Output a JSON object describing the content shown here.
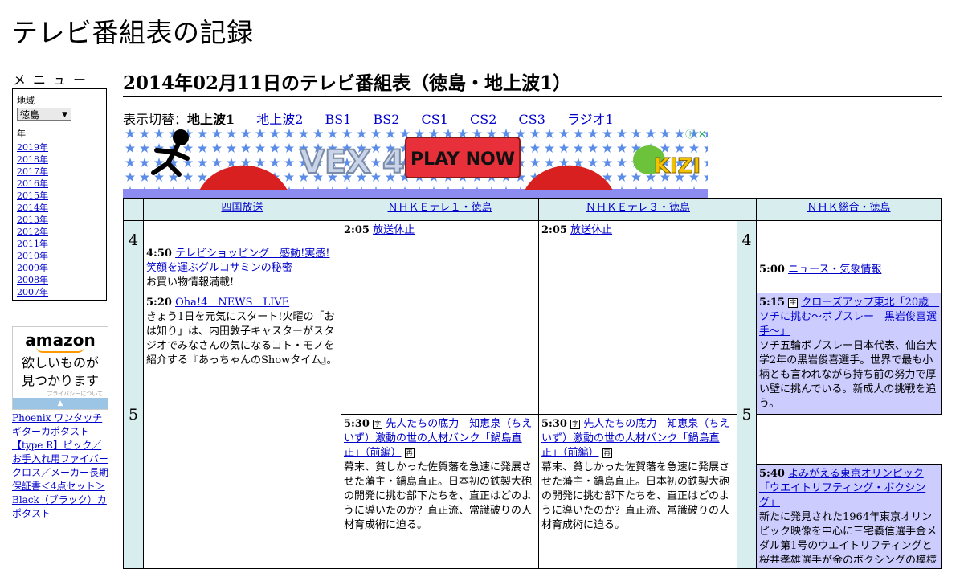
{
  "site_title": "テレビ番組表の記録",
  "menu": {
    "title": "メニュー",
    "region_label": "地域",
    "region_value": "徳島",
    "year_label": "年",
    "years": [
      "2019年",
      "2018年",
      "2017年",
      "2016年",
      "2015年",
      "2014年",
      "2013年",
      "2012年",
      "2011年",
      "2010年",
      "2009年",
      "2008年",
      "2007年"
    ]
  },
  "amazon_ad": {
    "logo": "amazon",
    "message_line1": "欲しいものが",
    "message_line2": "見つかります",
    "privacy": "プライバシーについて",
    "toggle": "▲"
  },
  "product_link": "Phoenix ワンタッチ ギターカポタスト【type R】ピック／お手入れ用ファイバークロス／メーカー長期保証書＜4点セット＞Black（ブラック）カポタスト",
  "page_title": "2014年02月11日のテレビ番組表（徳島・地上波1）",
  "switcher": {
    "label": "表示切替：",
    "current": "地上波1",
    "links": [
      "地上波2",
      "BS1",
      "BS2",
      "CS1",
      "CS2",
      "CS3",
      "ラジオ1"
    ]
  },
  "banner_ad": {
    "game": "VEX 4",
    "cta": "PLAY NOW",
    "brand": "KIZI",
    "info": "ⓘ",
    "close": "✕"
  },
  "schedule": {
    "channels": [
      "四国放送",
      "ＮＨＫＥテレ１・徳島",
      "ＮＨＫＥテレ３・徳島",
      "ＮＨＫ総合・徳島"
    ],
    "hours": [
      "4",
      "5"
    ],
    "programs": {
      "shikoku_450": {
        "time": "4:50",
        "title": "テレビショッピング　感動!実感!笑顔を運ぶグルコサミンの秘密",
        "desc": "お買い物情報満載!"
      },
      "shikoku_520": {
        "time": "5:20",
        "title": "Oha!4　NEWS　LIVE",
        "desc": "きょう1日を元気にスタート!火曜の「お は知り」は、内田敦子キャスターがスタジオでみなさんの気になるコト・モノを紹介する『あっちゃんのShowタイム』。"
      },
      "etv1_205": {
        "time": "2:05",
        "title": "放送休止"
      },
      "etv1_530": {
        "time": "5:30",
        "title": "先人たちの底力　知恵泉（ちえいず）激動の世の人材バンク「鍋島直正」（前編）",
        "desc": "幕末、貧しかった佐賀藩を急速に発展させた藩主・鍋島直正。日本初の鉄製大砲の開発に挑む部下たちを、直正はどのように導いたのか？直正流、常識破りの人材育成術に迫る。"
      },
      "etv3_205": {
        "time": "2:05",
        "title": "放送休止"
      },
      "etv3_530": {
        "time": "5:30",
        "title": "先人たちの底力　知恵泉（ちえいず）激動の世の人材バンク「鍋島直正」（前編）",
        "desc": "幕末、貧しかった佐賀藩を急速に発展させた藩主・鍋島直正。日本初の鉄製大砲の開発に挑む部下たちを、直正はどのように導いたのか？直正流、常識破りの人材育成術に迫る。"
      },
      "nhk_500": {
        "time": "5:00",
        "title": "ニュース・気象情報"
      },
      "nhk_515": {
        "time": "5:15",
        "title": "クローズアップ東北「20歳　ソチに挑む～ボブスレー　黒岩俊喜選手～」",
        "desc": "ソチ五輪ボブスレー日本代表、仙台大学2年の黒岩俊喜選手。世界で最も小柄とも言われながら持ち前の努力で厚い壁に挑んでいる。新成人の挑戦を追う。"
      },
      "nhk_540": {
        "time": "5:40",
        "title": "よみがえる東京オリンピック「ウエイトリフティング・ボクシング」",
        "desc": "新たに発見された1964年東京オリンピック映像を中心に三宅義信選手金メダル第1号のウエイトリフティングと桜井孝雄選手が金のボクシングの模様"
      }
    }
  }
}
